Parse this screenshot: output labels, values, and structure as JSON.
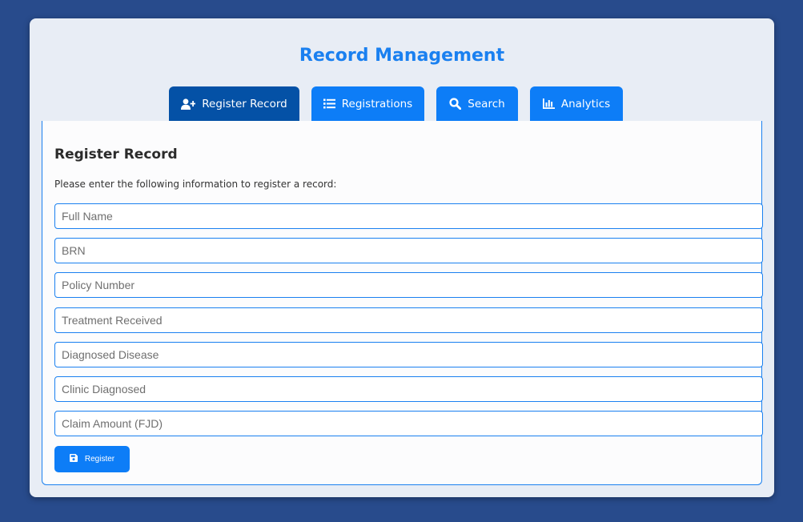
{
  "app": {
    "title": "Record Management"
  },
  "colors": {
    "page_background": "#284b8c",
    "panel_background": "#e8edf5",
    "accent": "#0d7df7",
    "tab_active": "#0451a6",
    "title_color": "#1a80f0"
  },
  "tabs": [
    {
      "label": "Register Record",
      "icon": "user-plus-icon",
      "active": true
    },
    {
      "label": "Registrations",
      "icon": "list-icon",
      "active": false
    },
    {
      "label": "Search",
      "icon": "search-icon",
      "active": false
    },
    {
      "label": "Analytics",
      "icon": "bar-chart-icon",
      "active": false
    }
  ],
  "form": {
    "title": "Register Record",
    "description": "Please enter the following information to register a record:",
    "fields": [
      {
        "placeholder": "Full Name",
        "value": ""
      },
      {
        "placeholder": "BRN",
        "value": ""
      },
      {
        "placeholder": "Policy Number",
        "value": ""
      },
      {
        "placeholder": "Treatment Received",
        "value": ""
      },
      {
        "placeholder": "Diagnosed Disease",
        "value": ""
      },
      {
        "placeholder": "Clinic Diagnosed",
        "value": ""
      },
      {
        "placeholder": "Claim Amount (FJD)",
        "value": ""
      }
    ],
    "submit": {
      "label": "Register",
      "icon": "save-icon"
    }
  }
}
